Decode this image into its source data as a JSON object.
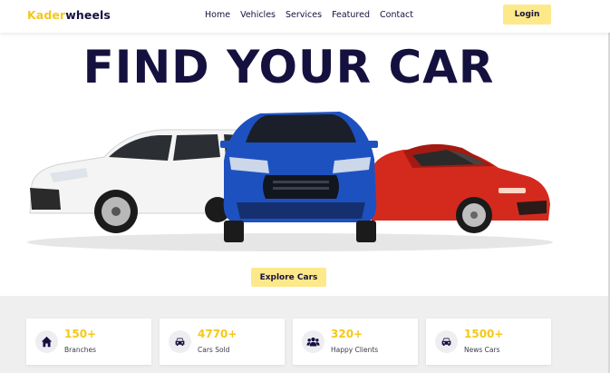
{
  "brand": {
    "part1": "Kader",
    "part2": "wheels"
  },
  "nav": {
    "items": [
      "Home",
      "Vehicles",
      "Services",
      "Featured",
      "Contact"
    ]
  },
  "login_label": "Login",
  "hero": {
    "title": "FIND YOUR CAR",
    "cta_label": "Explore Cars"
  },
  "colors": {
    "accent": "#fde98a",
    "brand_yellow": "#f4c81a",
    "navy": "#15113f",
    "stats_bg": "#efefef"
  },
  "stats": [
    {
      "value": "150+",
      "label": "Branches",
      "icon": "home-icon"
    },
    {
      "value": "4770+",
      "label": "Cars Sold",
      "icon": "car-icon"
    },
    {
      "value": "320+",
      "label": "Happy Clients",
      "icon": "users-icon"
    },
    {
      "value": "1500+",
      "label": "News Cars",
      "icon": "car-icon"
    }
  ]
}
